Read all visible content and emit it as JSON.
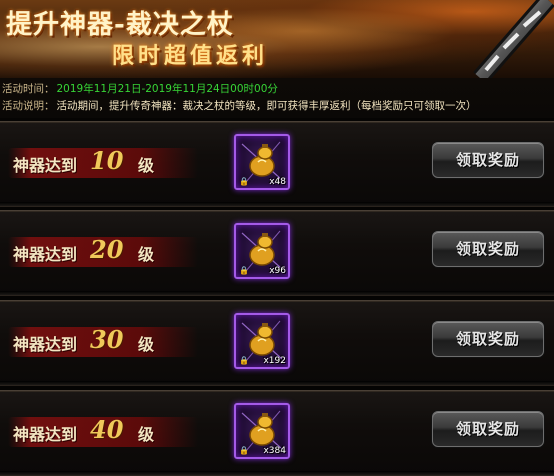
{
  "banner": {
    "title": "提升神器-裁决之杖",
    "subtitle": "限时超值返利"
  },
  "info": {
    "time_label": "活动时间：",
    "time_value": "2019年11月21日-2019年11月24日00时00分",
    "desc_label": "活动说明：",
    "desc_value": "活动期间，提升传奇神器：裁决之杖的等级，即可获得丰厚返利（每档奖励只可领取一次）"
  },
  "tiers": [
    {
      "prefix": "神器达到",
      "level": "10",
      "suffix": "级",
      "item_icon": "golden-gourd-icon",
      "quantity": "x48",
      "button_label": "领取奖励"
    },
    {
      "prefix": "神器达到",
      "level": "20",
      "suffix": "级",
      "item_icon": "golden-gourd-icon",
      "quantity": "x96",
      "button_label": "领取奖励"
    },
    {
      "prefix": "神器达到",
      "level": "30",
      "suffix": "级",
      "item_icon": "golden-gourd-icon",
      "quantity": "x192",
      "button_label": "领取奖励"
    },
    {
      "prefix": "神器达到",
      "level": "40",
      "suffix": "级",
      "item_icon": "golden-gourd-icon",
      "quantity": "x384",
      "button_label": "领取奖励"
    }
  ],
  "colors": {
    "time_value": "#37d536",
    "level_number": "#f0c95a",
    "item_border": "#a45ae8"
  }
}
